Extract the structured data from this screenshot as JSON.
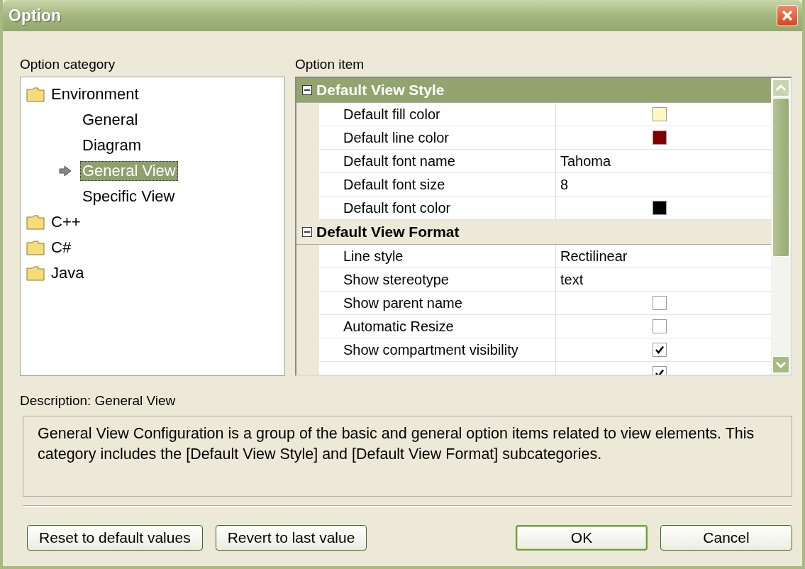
{
  "window": {
    "title": "Option"
  },
  "category_panel": {
    "label": "Option category",
    "tree": [
      {
        "label": "Environment",
        "selected": false,
        "children": [
          {
            "label": "General",
            "selected": false
          },
          {
            "label": "Diagram",
            "selected": false
          },
          {
            "label": "General View",
            "selected": true
          },
          {
            "label": "Specific View",
            "selected": false
          }
        ]
      },
      {
        "label": "C++",
        "selected": false
      },
      {
        "label": "C#",
        "selected": false
      },
      {
        "label": "Java",
        "selected": false
      }
    ]
  },
  "item_panel": {
    "label": "Option item",
    "groups": [
      {
        "title": "Default View Style",
        "expanded": true,
        "selected": true,
        "rows": [
          {
            "name": "Default fill color",
            "kind": "color",
            "color": "#fff8c0"
          },
          {
            "name": "Default line color",
            "kind": "color",
            "color": "#800000"
          },
          {
            "name": "Default font name",
            "kind": "text",
            "value": "Tahoma"
          },
          {
            "name": "Default font size",
            "kind": "text",
            "value": "8"
          },
          {
            "name": "Default font color",
            "kind": "color",
            "color": "#000000"
          }
        ]
      },
      {
        "title": "Default View Format",
        "expanded": true,
        "selected": false,
        "rows": [
          {
            "name": "Line style",
            "kind": "text",
            "value": "Rectilinear"
          },
          {
            "name": "Show stereotype",
            "kind": "text",
            "value": "text"
          },
          {
            "name": "Show parent name",
            "kind": "checkbox",
            "checked": false
          },
          {
            "name": "Automatic Resize",
            "kind": "checkbox",
            "checked": false
          },
          {
            "name": "Show compartment visibility",
            "kind": "checkbox",
            "checked": true
          },
          {
            "kind": "checkbox",
            "checked": true
          }
        ]
      }
    ]
  },
  "description": {
    "label": "Description: General View",
    "text": "General View Configuration is a group of the basic and general option items related to view elements. This category includes the [Default View Style] and [Default View Format] subcategories."
  },
  "buttons": [
    {
      "label": "Reset to default values",
      "default": false
    },
    {
      "label": "Revert to last value",
      "default": false
    },
    {
      "label": "OK",
      "default": true
    },
    {
      "label": "Cancel",
      "default": false
    }
  ]
}
